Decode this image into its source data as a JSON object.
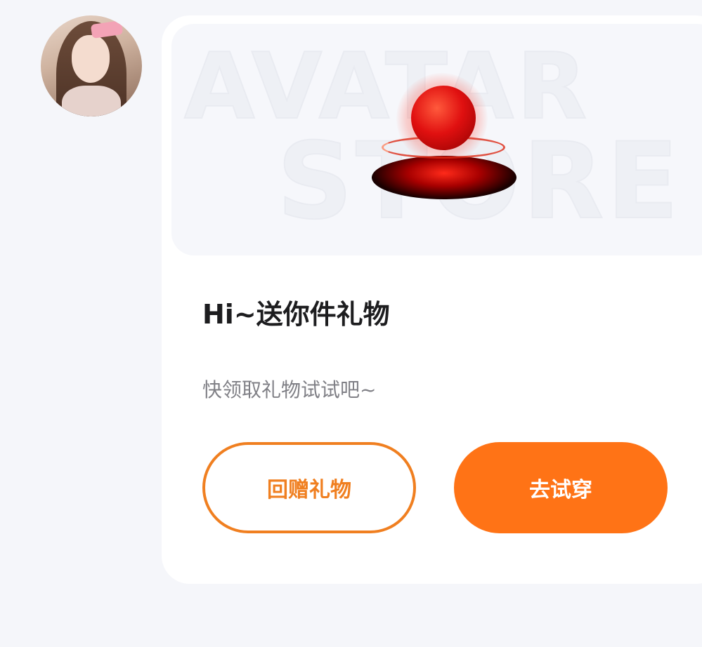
{
  "banner": {
    "watermark_line1": "AVATAR",
    "watermark_line2": "STORE",
    "item_icon": "red-orb-effect-icon"
  },
  "card": {
    "title": "Hi~送你件礼物",
    "subtitle": "快领取礼物试试吧~"
  },
  "buttons": {
    "return_gift": "回赠礼物",
    "try_on": "去试穿"
  },
  "colors": {
    "accent": "#ff7316",
    "outline": "#f07f20",
    "background": "#f5f6fa"
  }
}
